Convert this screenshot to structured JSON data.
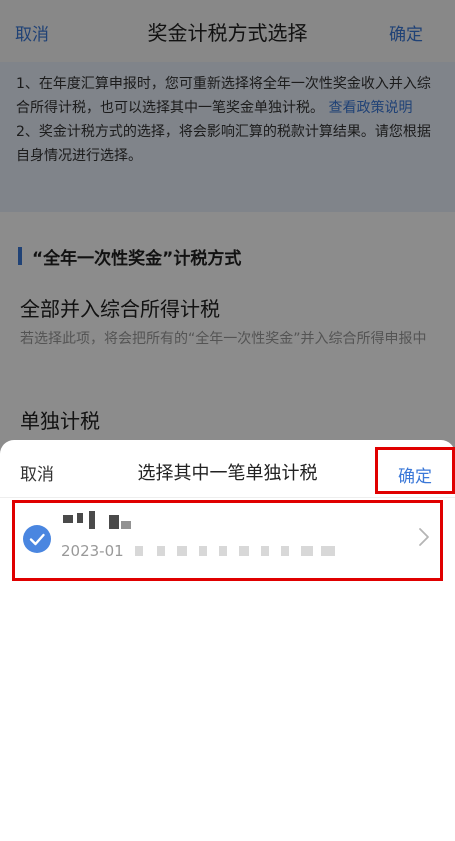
{
  "page": {
    "nav": {
      "cancel": "取消",
      "title": "奖金计税方式选择",
      "confirm": "确定"
    },
    "notice": {
      "line1": "1、在年度汇算申报时，您可重新选择将全年一次性奖金收入并入综合所得计税，也可以选择其中一笔奖金单独计税。",
      "link": "查看政策说明",
      "line2": "2、奖金计税方式的选择，将会影响汇算的税款计算结果。请您根据自身情况进行选择。"
    },
    "section_title": "“全年一次性奖金”计税方式",
    "options": [
      {
        "title": "全部并入综合所得计税",
        "desc": "若选择此项，将会把所有的“全年一次性奖金”并入综合所得申报中"
      },
      {
        "title": "单独计税",
        "desc": ""
      }
    ]
  },
  "sheet": {
    "cancel": "取消",
    "title": "选择其中一笔单独计税",
    "confirm": "确定",
    "record": {
      "date": "2023-01"
    }
  },
  "colors": {
    "accent": "#3b78d8",
    "highlight": "#e00000"
  },
  "icons": [
    "check-circle-icon",
    "chevron-right-icon"
  ]
}
